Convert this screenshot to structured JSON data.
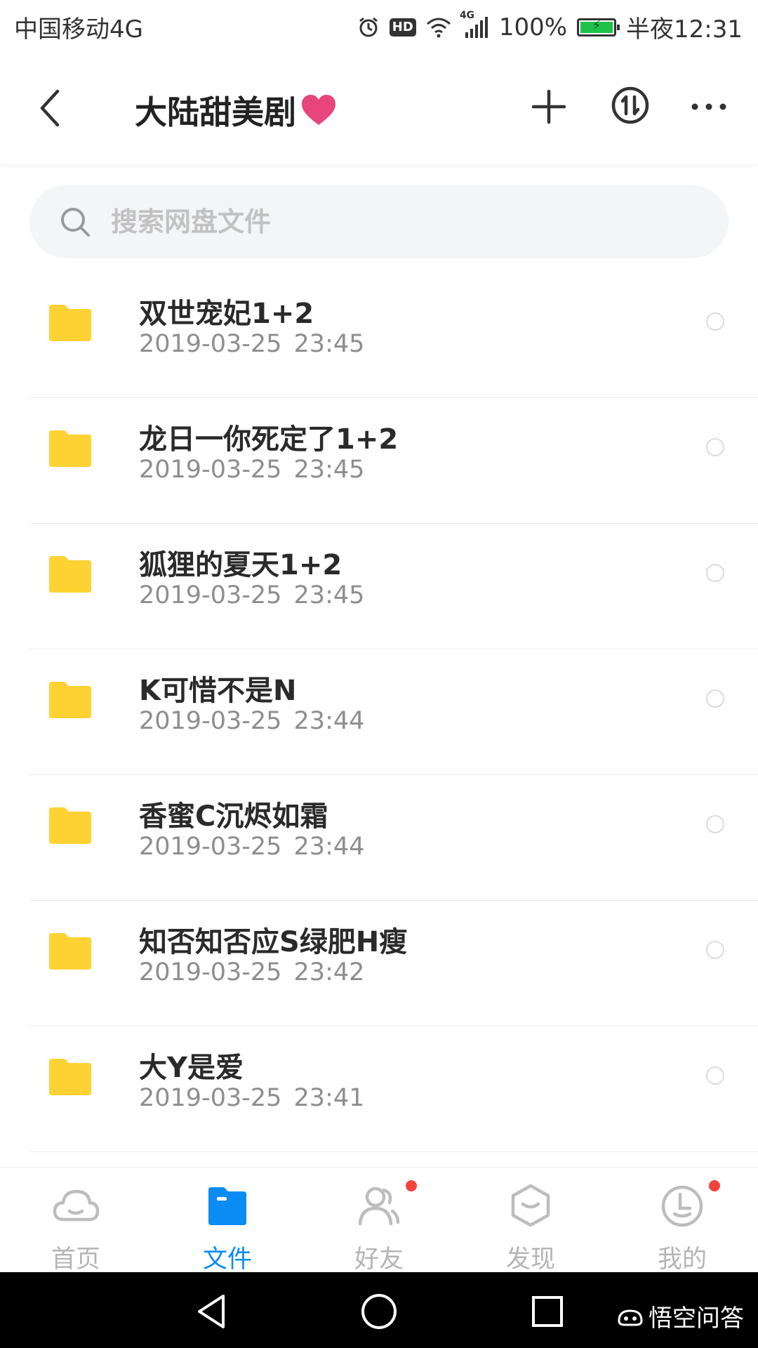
{
  "status_bar": {
    "carrier": "中国移动4G",
    "hd": "HD",
    "network": "4G",
    "battery_percent": "100%",
    "battery_level": 1.0,
    "time": "半夜12:31"
  },
  "header": {
    "title": "大陆甜美剧",
    "heart_color": "#e8457c"
  },
  "search": {
    "placeholder": "搜索网盘文件"
  },
  "files": [
    {
      "name": "双世宠妃1+2",
      "time": "2019-03-25 23:45"
    },
    {
      "name": "龙日一你死定了1+2",
      "time": "2019-03-25 23:45"
    },
    {
      "name": "狐狸的夏天1+2",
      "time": "2019-03-25 23:45"
    },
    {
      "name": "K可惜不是N",
      "time": "2019-03-25 23:44"
    },
    {
      "name": "香蜜C沉烬如霜",
      "time": "2019-03-25 23:44"
    },
    {
      "name": "知否知否应S绿肥H瘦",
      "time": "2019-03-25 23:42"
    },
    {
      "name": "大Y是爱",
      "time": "2019-03-25 23:41"
    }
  ],
  "tabs": [
    {
      "label": "首页",
      "icon": "cloud-icon",
      "active": false,
      "badge": false
    },
    {
      "label": "文件",
      "icon": "folder-icon",
      "active": true,
      "badge": false
    },
    {
      "label": "好友",
      "icon": "friends-icon",
      "active": false,
      "badge": true
    },
    {
      "label": "发现",
      "icon": "discover-icon",
      "active": false,
      "badge": false
    },
    {
      "label": "我的",
      "icon": "profile-icon",
      "active": false,
      "badge": true
    }
  ],
  "colors": {
    "accent": "#0b8cf5",
    "folder": "#ffd234",
    "badge": "#f4433c",
    "inactive": "#b5b5b5"
  },
  "watermark": "悟空问答"
}
